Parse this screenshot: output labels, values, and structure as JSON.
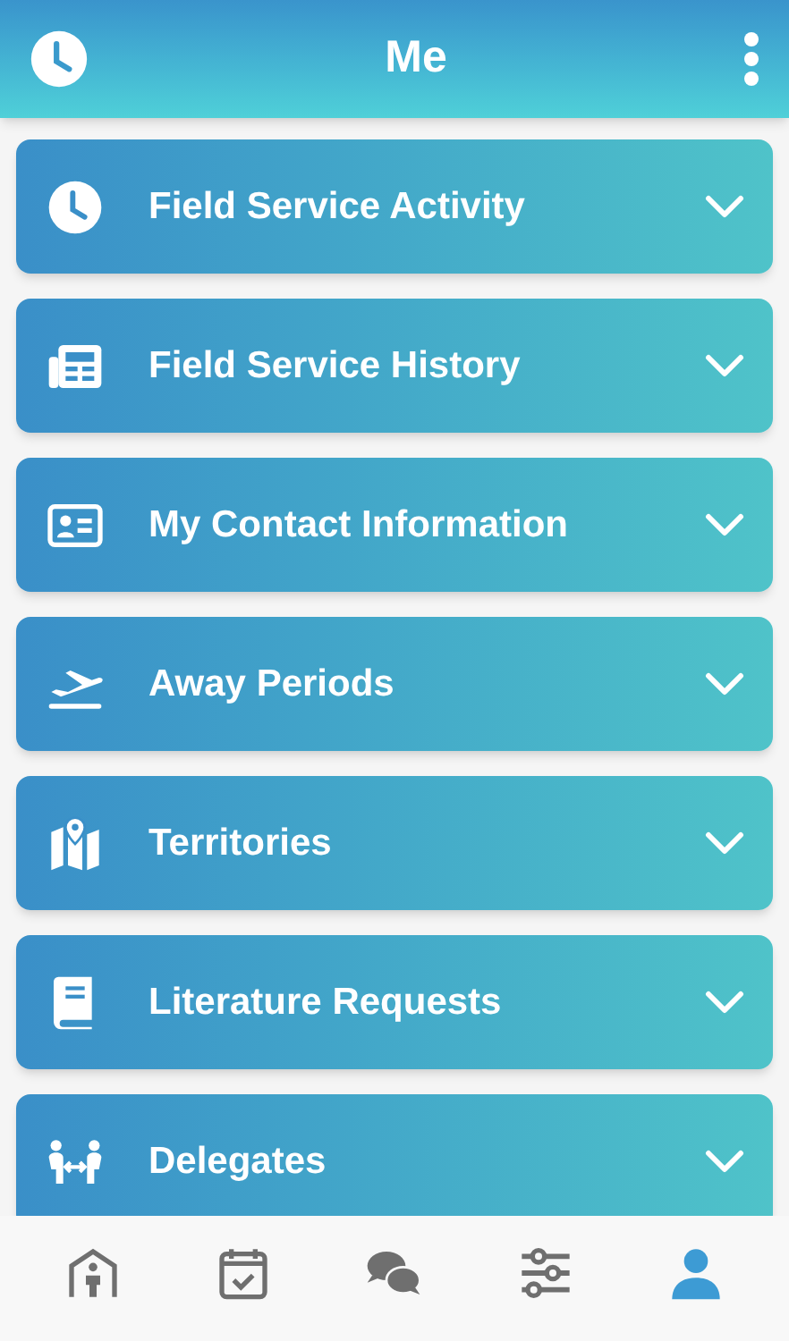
{
  "header": {
    "title": "Me"
  },
  "sections": [
    {
      "title": "Field Service Activity",
      "expanded": false
    },
    {
      "title": "Field Service History",
      "expanded": false
    },
    {
      "title": "My Contact Information",
      "expanded": false
    },
    {
      "title": "Away Periods",
      "expanded": false
    },
    {
      "title": "Territories",
      "expanded": false
    },
    {
      "title": "Literature Requests",
      "expanded": false
    },
    {
      "title": "Delegates",
      "expanded": false
    }
  ],
  "bottom_nav": [
    {
      "selected": false
    },
    {
      "selected": false
    },
    {
      "selected": false
    },
    {
      "selected": false
    },
    {
      "selected": true
    }
  ]
}
